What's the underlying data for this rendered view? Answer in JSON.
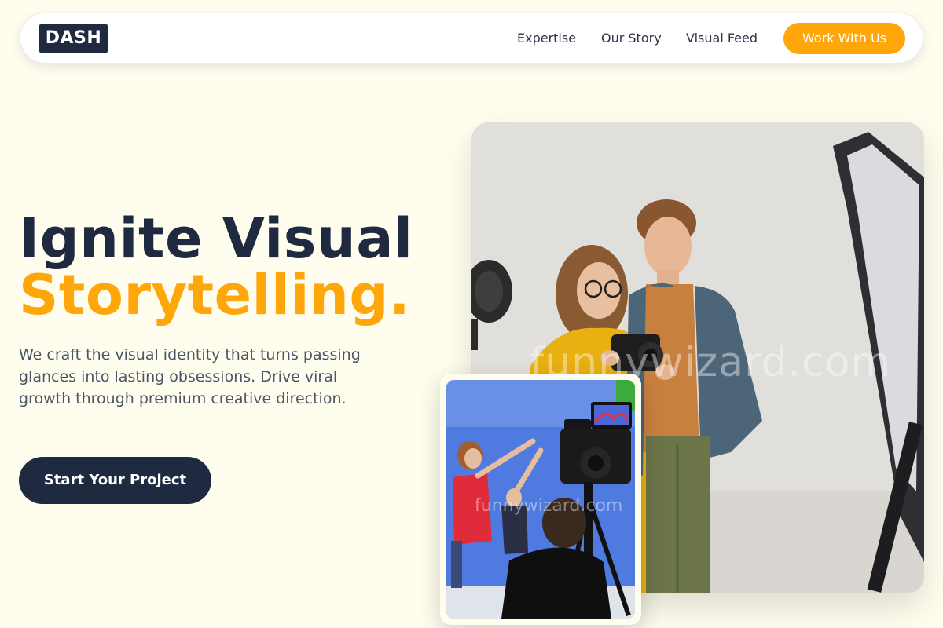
{
  "nav": {
    "logo": "DASH",
    "links": [
      "Expertise",
      "Our Story",
      "Visual Feed"
    ],
    "cta": "Work With Us"
  },
  "hero": {
    "headline_line1": "Ignite Visual",
    "headline_line2": "Storytelling.",
    "subcopy": "We craft the visual identity that turns passing glances into lasting obsessions. Drive viral growth through premium creative direction.",
    "cta": "Start Your Project"
  },
  "images": {
    "main_watermark": "funnywizard.com",
    "inset_watermark": "funnywizard.com"
  },
  "colors": {
    "background": "#fefdee",
    "navy": "#1f2a40",
    "accent": "#ffa70a"
  }
}
